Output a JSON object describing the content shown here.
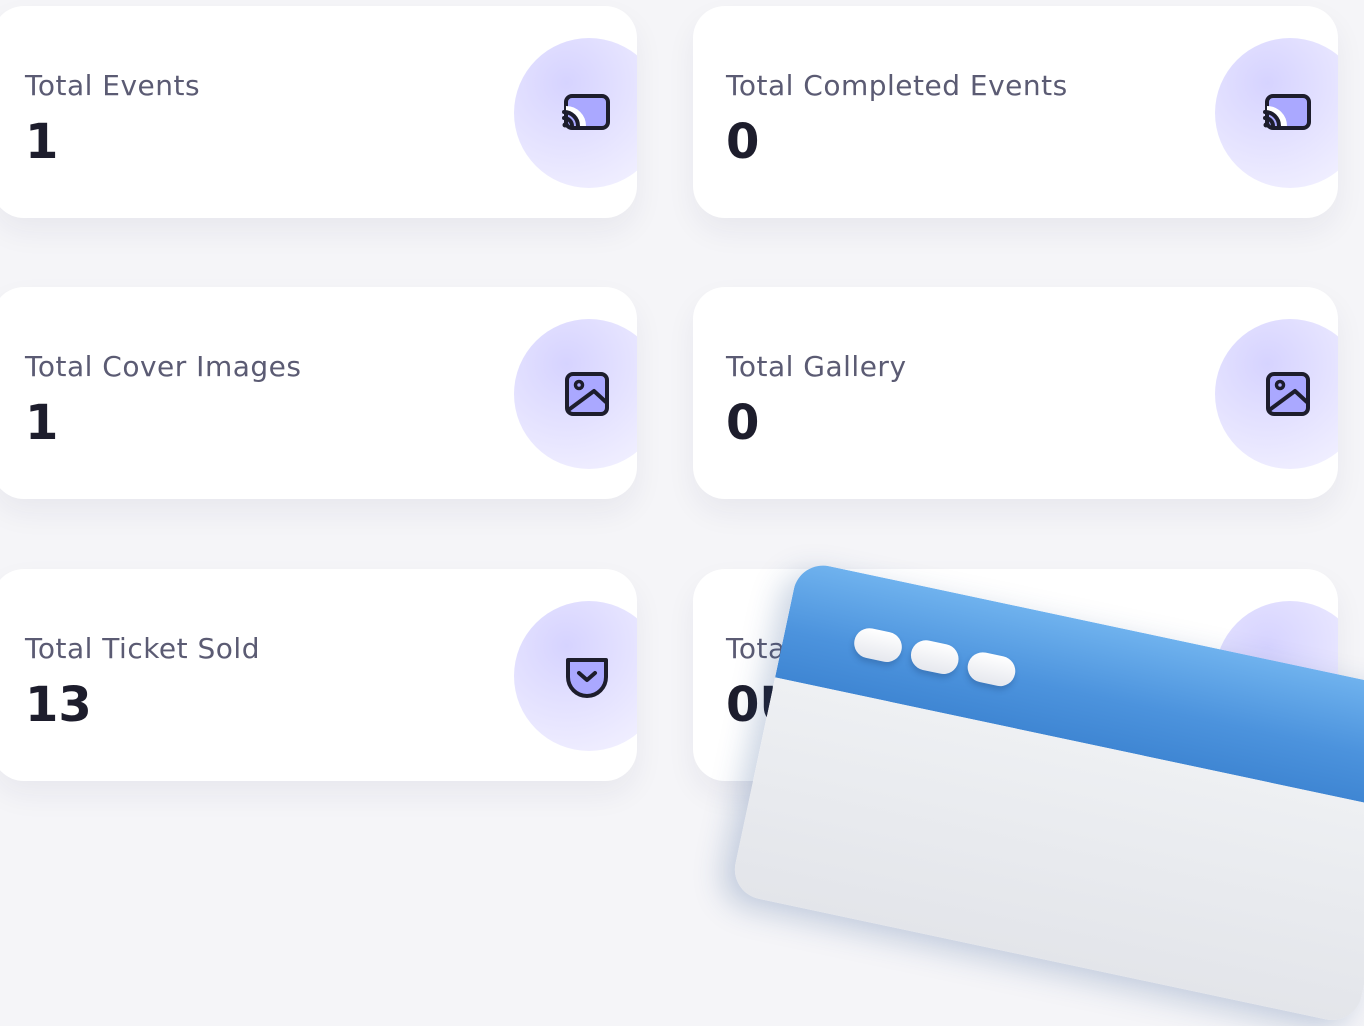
{
  "cards": [
    {
      "label": "Total Events",
      "value": "1",
      "icon": "cast-icon"
    },
    {
      "label": "Total Completed Events",
      "value": "0",
      "icon": "cast-icon"
    },
    {
      "label": "Total Cover Images",
      "value": "1",
      "icon": "image-icon"
    },
    {
      "label": "Total Gallery",
      "value": "0",
      "icon": "image-icon"
    },
    {
      "label": "Total Ticket Sold",
      "value": "13",
      "icon": "pocket-icon"
    },
    {
      "label": "Total",
      "value": "0U",
      "icon": ""
    }
  ],
  "colors": {
    "accent": "#aaa8ff",
    "icon_stroke": "#1d1d2c",
    "circle": "#e3e1ff",
    "window_blue": "#4c93dd"
  }
}
